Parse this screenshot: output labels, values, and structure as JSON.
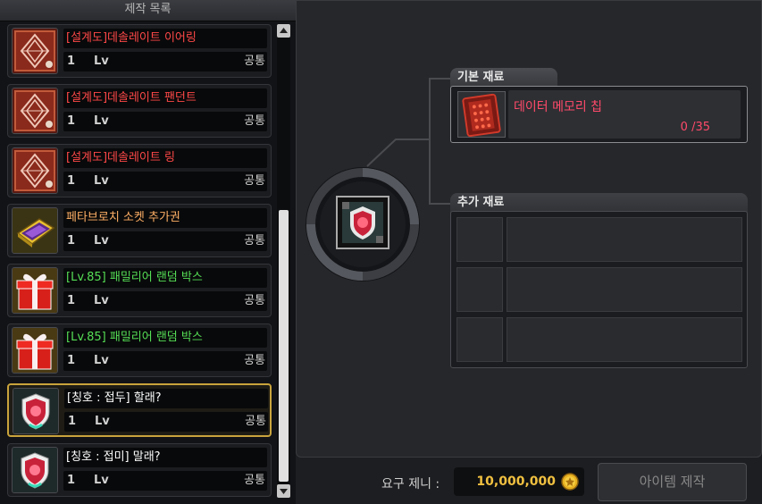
{
  "list_title": "제작 목록",
  "items": [
    {
      "name": "[설계도]데솔레이트 이어링",
      "count": "1",
      "lv": "Lv",
      "class": "공통",
      "color": "#ff4848",
      "icon": "blueprint-icon"
    },
    {
      "name": "[설계도]데솔레이트 팬던트",
      "count": "1",
      "lv": "Lv",
      "class": "공통",
      "color": "#ff4848",
      "icon": "blueprint-icon"
    },
    {
      "name": "[설계도]데솔레이트 링",
      "count": "1",
      "lv": "Lv",
      "class": "공통",
      "color": "#ff4848",
      "icon": "blueprint-icon"
    },
    {
      "name": "페타브로치 소켓 추가권",
      "count": "1",
      "lv": "Lv",
      "class": "공통",
      "color": "#ffb066",
      "icon": "socket-ticket-icon"
    },
    {
      "name": "[Lv.85] 패밀리어 랜덤 박스",
      "count": "1",
      "lv": "Lv",
      "class": "공통",
      "color": "#55dd55",
      "icon": "gift-box-icon"
    },
    {
      "name": "[Lv.85] 패밀리어 랜덤 박스",
      "count": "1",
      "lv": "Lv",
      "class": "공통",
      "color": "#55dd55",
      "icon": "gift-box-icon"
    },
    {
      "name": "[칭호 : 접두] 할래?",
      "count": "1",
      "lv": "Lv",
      "class": "공통",
      "color": "#ffffff",
      "icon": "title-medal-icon",
      "selected": true
    },
    {
      "name": "[칭호 : 접미] 말래?",
      "count": "1",
      "lv": "Lv",
      "class": "공통",
      "color": "#ffffff",
      "icon": "title-medal-icon"
    }
  ],
  "base_material": {
    "title": "기본 재료",
    "name": "데이터 메모리 칩",
    "count": "0 /35",
    "icon": "memory-chip-icon"
  },
  "extra_material": {
    "title": "추가 재료"
  },
  "zeni": {
    "label": "요구 제니 :",
    "value": "10,000,000"
  },
  "craft_button": "아이템 제작"
}
